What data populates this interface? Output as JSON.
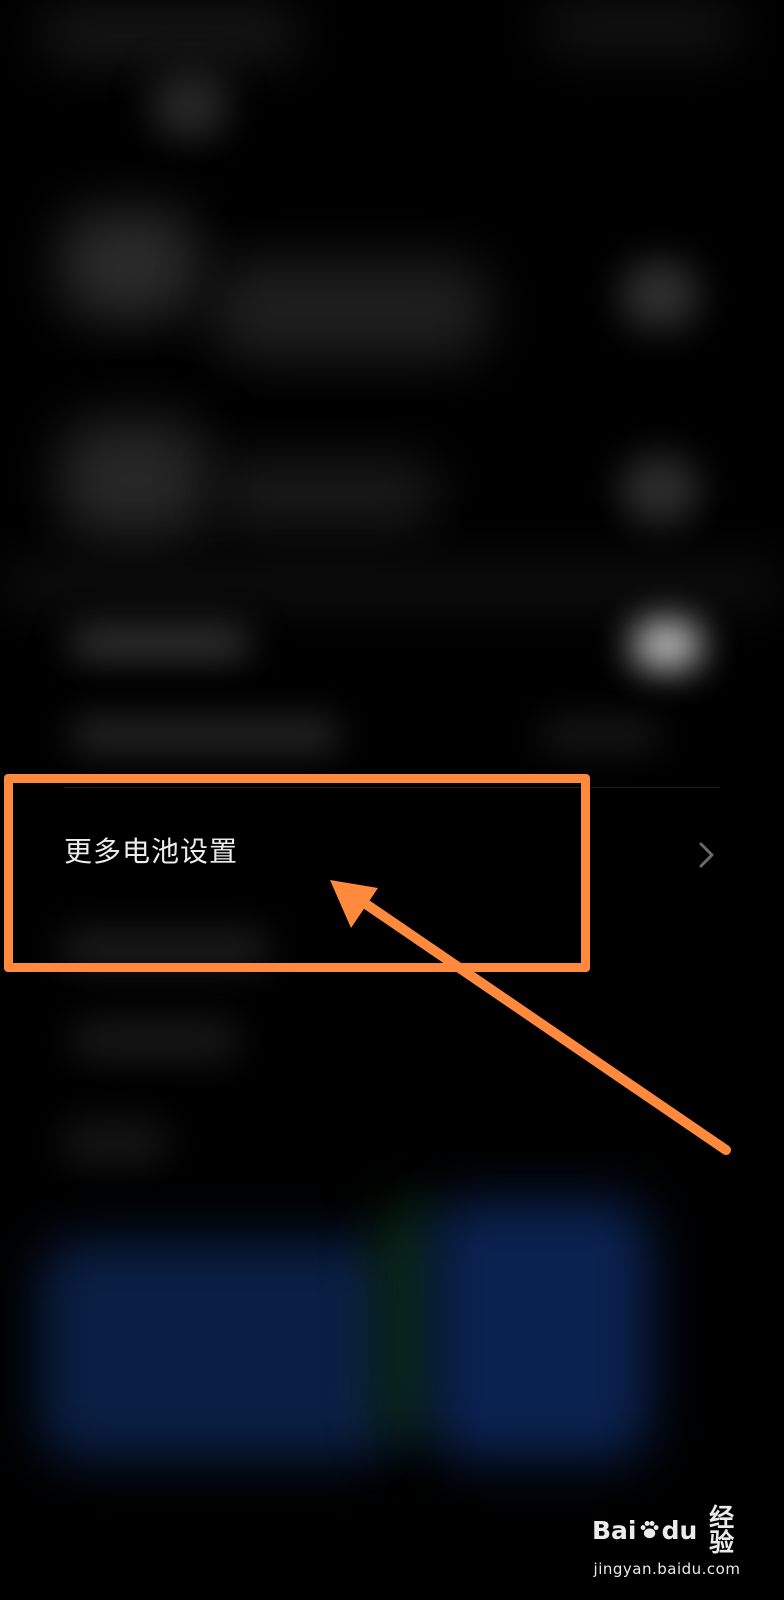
{
  "settings": {
    "more_battery_settings": {
      "label": "更多电池设置",
      "icon": "chevron-right-icon"
    }
  },
  "annotation": {
    "color": "#ff8a3d"
  },
  "watermark": {
    "logo_prefix": "Bai",
    "logo_suffix": "du",
    "logo_cn": "经验",
    "url": "jingyan.baidu.com"
  }
}
